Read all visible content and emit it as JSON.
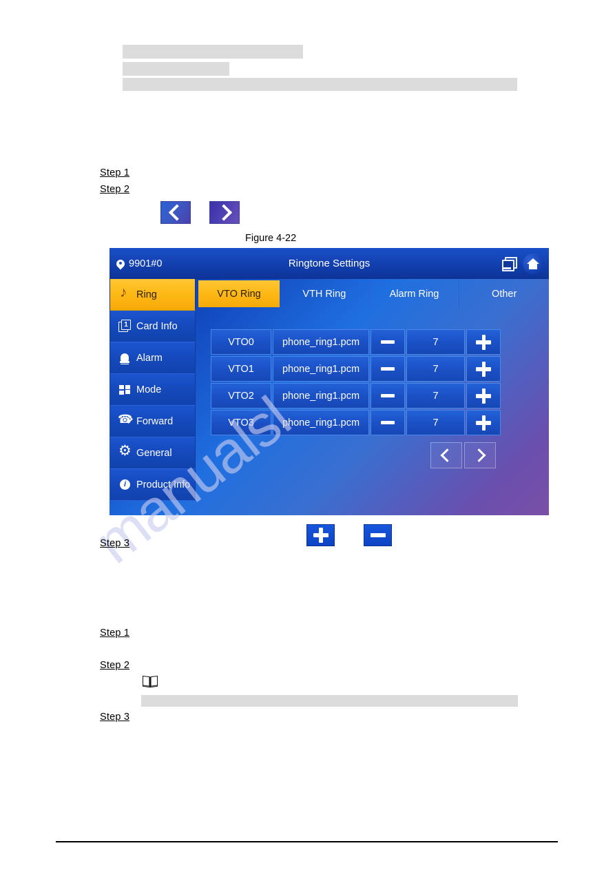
{
  "document": {
    "figure_caption": "Figure 4-22",
    "steps": [
      {
        "label": "Step 1"
      },
      {
        "label": "Step 2"
      },
      {
        "label": "Step 3"
      },
      {
        "label": "Step 1"
      },
      {
        "label": "Step 2"
      },
      {
        "label": "Step 3"
      }
    ],
    "watermark": "manualsl",
    "illustration_buttons": {
      "prev_arrow": "chevron-left",
      "next_arrow": "chevron-right",
      "plus": "plus",
      "minus": "minus"
    },
    "note_icon": "book-icon"
  },
  "device": {
    "header": {
      "location": "9901#0",
      "title": "Ringtone Settings",
      "icons": [
        "screens-icon",
        "home-icon"
      ]
    },
    "sidebar": {
      "items": [
        {
          "label": "Ring",
          "icon": "music-note-icon",
          "active": true
        },
        {
          "label": "Card Info",
          "icon": "card-icon",
          "active": false
        },
        {
          "label": "Alarm",
          "icon": "bell-icon",
          "active": false
        },
        {
          "label": "Mode",
          "icon": "grid-icon",
          "active": false
        },
        {
          "label": "Forward",
          "icon": "call-forward-icon",
          "active": false
        },
        {
          "label": "General",
          "icon": "gear-icon",
          "active": false
        },
        {
          "label": "Product Info",
          "icon": "info-icon",
          "active": false
        }
      ]
    },
    "tabs": [
      {
        "label": "VTO Ring",
        "active": true
      },
      {
        "label": "VTH Ring",
        "active": false
      },
      {
        "label": "Alarm Ring",
        "active": false
      },
      {
        "label": "Other",
        "active": false
      }
    ],
    "table": {
      "rows": [
        {
          "name": "VTO0",
          "file": "phone_ring1.pcm",
          "volume": "7"
        },
        {
          "name": "VTO1",
          "file": "phone_ring1.pcm",
          "volume": "7"
        },
        {
          "name": "VTO2",
          "file": "phone_ring1.pcm",
          "volume": "7"
        },
        {
          "name": "VTO3",
          "file": "phone_ring1.pcm",
          "volume": "7"
        }
      ],
      "decrease_icon": "minus-icon",
      "increase_icon": "plus-icon"
    },
    "pager": {
      "prev": "chevron-left-icon",
      "next": "chevron-right-icon"
    },
    "colors": {
      "accent_yellow": "#fdb713",
      "header_blue": "#123fae",
      "panel_blue": "#1549bc",
      "cell_blue": "#1b51c6"
    }
  }
}
